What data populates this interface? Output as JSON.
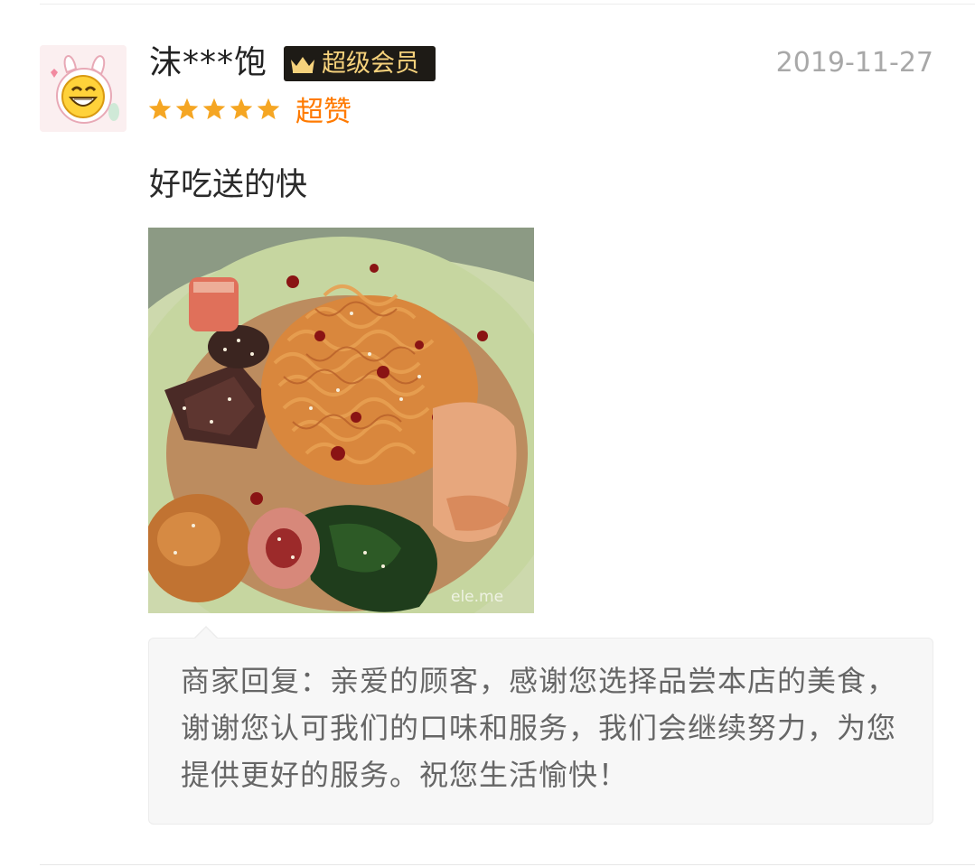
{
  "review": {
    "username": "沫***饱",
    "vip_label": "超级会员",
    "date": "2019-11-27",
    "rating": 5,
    "rating_max": 5,
    "rating_text": "超赞",
    "comment": "好吃送的快",
    "photo_watermark": "ele.me"
  },
  "merchant_reply": {
    "text": "商家回复：亲爱的顾客，感谢您选择品尝本店的美食，谢谢您认可我们的口味和服务，我们会继续努力，为您提供更好的服务。祝您生活愉快！"
  },
  "colors": {
    "star": "#f5a623",
    "rating_text": "#ff7a00",
    "vip_badge_bg": "#1e1b16",
    "vip_badge_text": "#f6d27c",
    "date": "#a8a8a8",
    "reply_bg": "#f7f7f7"
  },
  "icons": {
    "avatar": "smiling-bunny-avatar",
    "vip": "crown-icon",
    "star": "star-icon"
  }
}
